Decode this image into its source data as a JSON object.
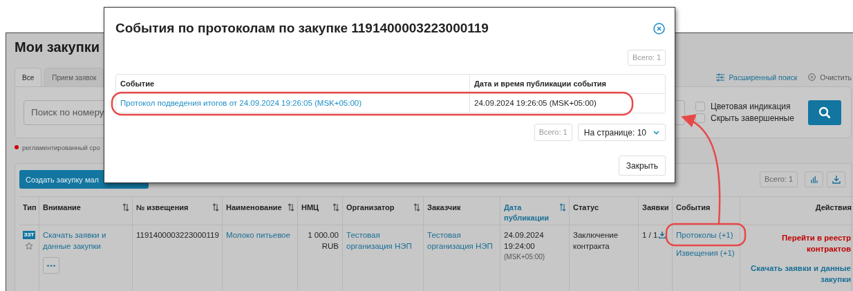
{
  "page": {
    "title": "Мои закупки",
    "tabs": [
      {
        "label": "Все",
        "selected": true
      },
      {
        "label": "Прием заявок",
        "selected": false
      }
    ],
    "advanced_search": "Расширенный поиск",
    "clear": "Очистить",
    "search": {
      "placeholder": "Поиск по номеру"
    },
    "options": [
      {
        "label": "Цветовая индикация",
        "checked": false
      },
      {
        "label": "Скрыть завершенные",
        "checked": false
      }
    ],
    "legend": "регламентированный сро",
    "create_button": "Создать закупку мал",
    "total": "Всего: 1",
    "table": {
      "columns": [
        {
          "label": "Тип",
          "sortable": false,
          "active": false
        },
        {
          "label": "Внимание",
          "sortable": true,
          "active": false
        },
        {
          "label": "№ извещения",
          "sortable": true,
          "active": false
        },
        {
          "label": "Наименование",
          "sortable": true,
          "active": false
        },
        {
          "label": "НМЦ",
          "sortable": true,
          "active": false
        },
        {
          "label": "Организатор",
          "sortable": true,
          "active": false
        },
        {
          "label": "Заказчик",
          "sortable": false,
          "active": false
        },
        {
          "label": "Дата публикации",
          "sortable": true,
          "active": true
        },
        {
          "label": "Статус",
          "sortable": false,
          "active": false
        },
        {
          "label": "Заявки",
          "sortable": false,
          "active": false
        },
        {
          "label": "События",
          "sortable": false,
          "active": false
        },
        {
          "label": "Действия",
          "sortable": false,
          "active": false
        }
      ],
      "rows": [
        {
          "type": "ЗЗТ",
          "attention": "Скачать заявки и данные закупки",
          "notice": "1191400003223000119",
          "name": "Молоко питьевое",
          "price": "1 000.00",
          "currency": "RUB",
          "organizer": "Тестовая организация НЭП",
          "customer": "Тестовая организация НЭП",
          "date": "24.09.2024 19:24:00",
          "timezone": "(MSK+05:00)",
          "status": "Заключение контракта",
          "bids": "1 / 1",
          "events": [
            "Протоколы (+1)",
            "Извещения (+1)"
          ],
          "actions": [
            {
              "label": "Перейти в реестр контрактов",
              "kind": "danger"
            },
            {
              "label": "Скачать заявки и данные закупки",
              "kind": "primary"
            }
          ]
        }
      ]
    }
  },
  "modal": {
    "title": "События по протоколам по закупке 1191400003223000119",
    "total_top": "Всего: 1",
    "columns": [
      "Событие",
      "Дата и время публикации события"
    ],
    "rows": [
      {
        "event": "Протокол подведения итогов от 24.09.2024 19:26:05 (MSK+05:00)",
        "published": "24.09.2024 19:26:05 (MSK+05:00)"
      }
    ],
    "total": "Всего: 1",
    "page_size": "На странице: 10",
    "close_button": "Закрыть"
  }
}
